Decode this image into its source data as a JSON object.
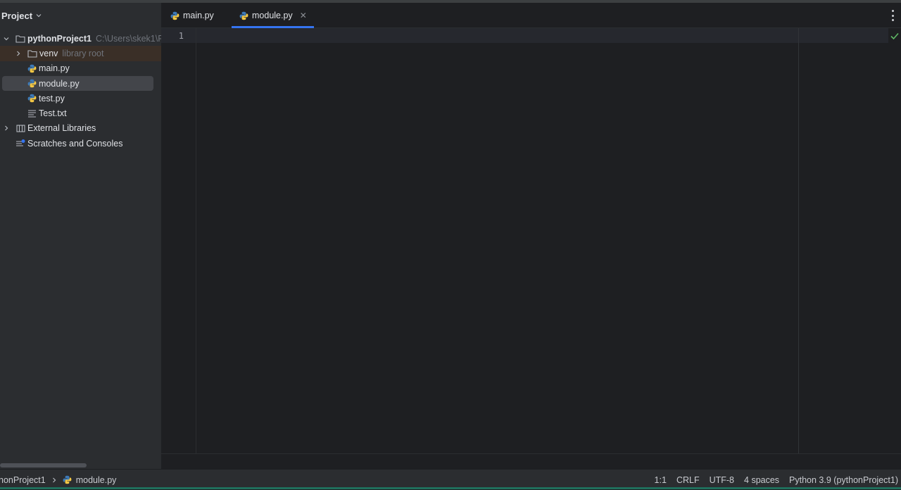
{
  "project_panel": {
    "title": "Project",
    "tree": {
      "root": {
        "name": "pythonProject1",
        "path": "C:\\Users\\skek1\\F"
      },
      "venv": {
        "name": "venv",
        "hint": "library root"
      },
      "files": [
        {
          "name": "main.py",
          "icon": "python-file-icon"
        },
        {
          "name": "module.py",
          "icon": "python-file-icon"
        },
        {
          "name": "test.py",
          "icon": "python-file-icon"
        },
        {
          "name": "Test.txt",
          "icon": "text-file-icon"
        }
      ],
      "external_libraries": "External Libraries",
      "scratches": "Scratches and Consoles"
    }
  },
  "editor": {
    "tabs": [
      {
        "label": "main.py",
        "active": false
      },
      {
        "label": "module.py",
        "active": true
      }
    ],
    "line_numbers": [
      "1"
    ]
  },
  "statusbar": {
    "breadcrumb_project": "honProject1",
    "breadcrumb_file": "module.py",
    "position": "1:1",
    "line_separator": "CRLF",
    "encoding": "UTF-8",
    "indent": "4 spaces",
    "interpreter": "Python 3.9 (pythonProject1)"
  },
  "colors": {
    "accent": "#3574f0",
    "python_blue": "#3d7ab8",
    "python_yellow": "#f3c744",
    "ok_green": "#5fb865"
  }
}
